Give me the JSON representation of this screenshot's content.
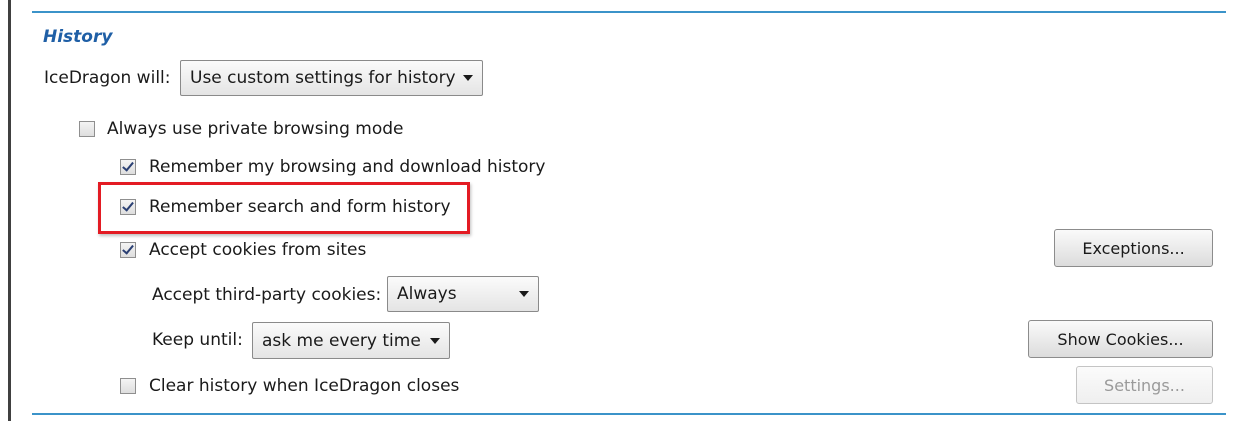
{
  "section": {
    "title": "History"
  },
  "history_mode": {
    "label": "IceDragon will:",
    "selected": "Use custom settings for history"
  },
  "options": {
    "private_browsing": "Always use private browsing mode",
    "remember_browsing": "Remember my browsing and download history",
    "remember_search": "Remember search and form history",
    "accept_cookies": "Accept cookies from sites",
    "clear_history": "Clear history when IceDragon closes"
  },
  "states": {
    "private_browsing": false,
    "remember_browsing": true,
    "remember_search": true,
    "accept_cookies": true,
    "clear_history": false
  },
  "third_party": {
    "label": "Accept third-party cookies:",
    "selected": "Always"
  },
  "keep_until": {
    "label": "Keep until:",
    "selected": "ask me every time"
  },
  "buttons": {
    "exceptions": "Exceptions...",
    "show_cookies": "Show Cookies...",
    "settings": "Settings..."
  },
  "colors": {
    "accent": "#3b93c9",
    "title": "#1f5fa6",
    "highlight": "#e31b23"
  }
}
